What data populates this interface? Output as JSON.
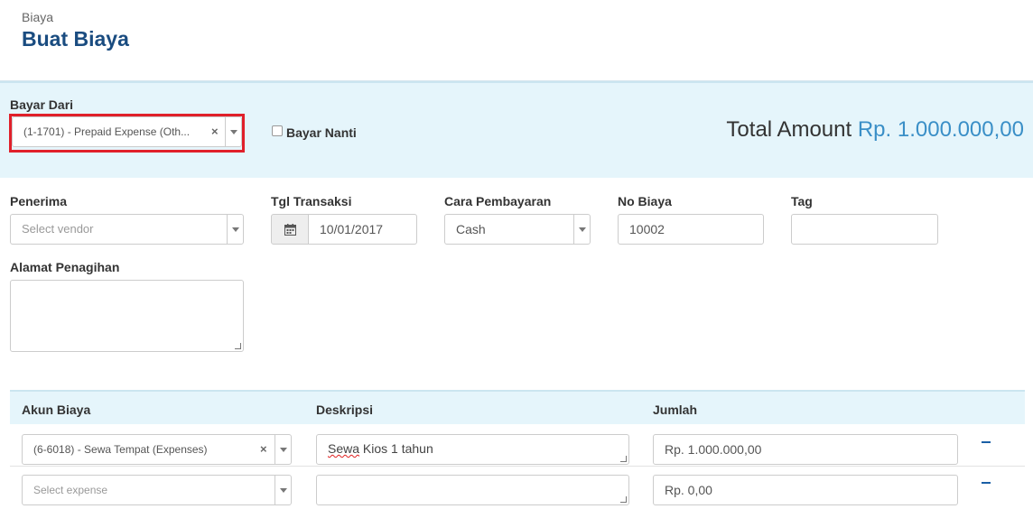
{
  "header": {
    "breadcrumb": "Biaya",
    "title": "Buat Biaya"
  },
  "pay": {
    "bayar_dari_label": "Bayar Dari",
    "bayar_dari_value": "(1-1701) - Prepaid Expense (Oth...",
    "clear_glyph": "×",
    "bayar_nanti_label": "Bayar Nanti",
    "bayar_nanti_checked": false,
    "total_label": "Total Amount",
    "total_value": "Rp. 1.000.000,00"
  },
  "form": {
    "penerima_label": "Penerima",
    "penerima_placeholder": "Select vendor",
    "tgl_label": "Tgl Transaksi",
    "tgl_value": "10/01/2017",
    "cara_label": "Cara Pembayaran",
    "cara_value": "Cash",
    "no_label": "No Biaya",
    "no_value": "10002",
    "tag_label": "Tag",
    "tag_value": "",
    "alamat_label": "Alamat Penagihan",
    "alamat_value": ""
  },
  "table": {
    "headers": {
      "akun": "Akun Biaya",
      "deskripsi": "Deskripsi",
      "jumlah": "Jumlah"
    },
    "rows": [
      {
        "akun": "(6-6018) - Sewa Tempat (Expenses)",
        "akun_placeholder": false,
        "deskripsi_word1": "Sewa",
        "deskripsi_rest": " Kios 1 tahun",
        "jumlah": "Rp. 1.000.000,00"
      },
      {
        "akun": "Select expense",
        "akun_placeholder": true,
        "deskripsi_word1": "",
        "deskripsi_rest": "",
        "jumlah": "Rp. 0,00"
      }
    ]
  },
  "icons": {
    "calendar": "calendar-icon",
    "dropdown": "chevron-down-icon",
    "clear": "clear-icon",
    "remove": "minus-icon"
  },
  "colors": {
    "title": "#1a4c80",
    "total_amount": "#3a8fc7",
    "band": "#e5f5fb",
    "highlight": "#e0202a",
    "remove": "#1a5fa6"
  }
}
